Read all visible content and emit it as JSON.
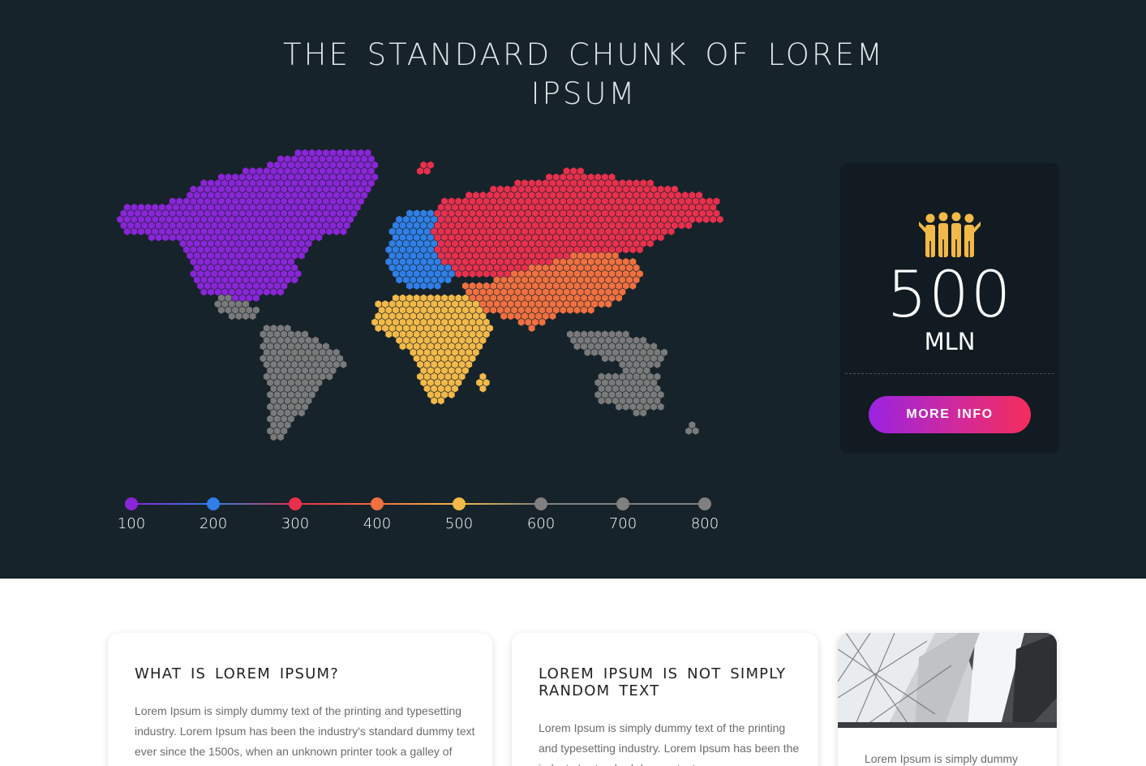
{
  "hero": {
    "title": "THE STANDARD CHUNK OF LOREM IPSUM"
  },
  "colors": {
    "background": "#17232a",
    "north_america": "#8a25d8",
    "europe": "#2f7fe6",
    "russia_asia": "#e8304d",
    "south_asia": "#f07040",
    "africa": "#f3b948",
    "grey_regions": "#7a7a7a"
  },
  "timeline": {
    "stops": [
      {
        "label": "100",
        "color": "#8a25d8"
      },
      {
        "label": "200",
        "color": "#2f7fe6"
      },
      {
        "label": "300",
        "color": "#e8304d"
      },
      {
        "label": "400",
        "color": "#f07040"
      },
      {
        "label": "500",
        "color": "#f3b948"
      },
      {
        "label": "600",
        "color": "#808080"
      },
      {
        "label": "700",
        "color": "#808080"
      },
      {
        "label": "800",
        "color": "#808080"
      }
    ]
  },
  "stat": {
    "icon": "people-group-icon",
    "value": "500",
    "unit": "MLN",
    "button_label": "MORE INFO"
  },
  "cards": [
    {
      "title": "WHAT IS LOREM IPSUM?",
      "body": "Lorem Ipsum is simply dummy text of the printing and typesetting industry. Lorem Ipsum has been the industry's standard dummy text ever since the 1500s, when an unknown printer took a galley of type"
    },
    {
      "title": "LOREM IPSUM IS NOT SIMPLY RANDOM TEXT",
      "body": "Lorem Ipsum is simply dummy text of the printing and typesetting industry. Lorem Ipsum has been the industry's standard dummy text ever"
    },
    {
      "image": "architecture-photo",
      "body": "Lorem Ipsum is simply dummy"
    }
  ]
}
